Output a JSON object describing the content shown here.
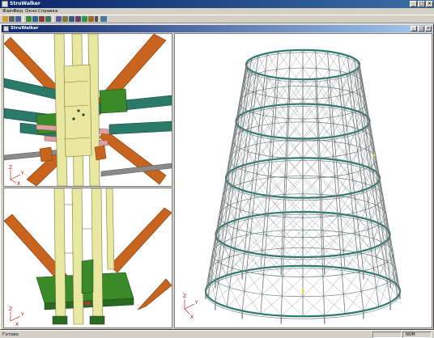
{
  "app": {
    "title": "StruWalker",
    "window_controls": {
      "minimize": "_",
      "maximize": "□",
      "close": "×"
    }
  },
  "menu": [
    "Файл",
    "Вид",
    "Окно",
    "Справка"
  ],
  "toolbar": {
    "icons": [
      "open-icon",
      "print-icon",
      "save-icon",
      "select-icon",
      "zoom-icon",
      "rotate-icon",
      "refresh-icon",
      "view-icon",
      "camera-icon",
      "pan-icon",
      "walk-icon",
      "light-icon",
      "settings-icon",
      "dropdown-icon",
      "measure-icon"
    ]
  },
  "child_window": {
    "title": "StruWalker",
    "controls": {
      "minimize": "_",
      "maximize": "□",
      "close": "×"
    }
  },
  "viewports": {
    "top_left": {
      "axis_labels": {
        "x": "X",
        "y": "Y",
        "z": "Z"
      }
    },
    "bottom_left": {
      "axis_labels": {
        "x": "X",
        "y": "Y",
        "z": "Z"
      }
    },
    "right": {
      "axis_labels": {
        "x": "X",
        "y": "Y",
        "z": "Z"
      }
    }
  },
  "status": {
    "text": "Готово",
    "indicator": "NUM"
  },
  "colors": {
    "steel_yellow": "#e8e8a0",
    "steel_orange": "#c8641e",
    "steel_teal": "#2a7a6a",
    "steel_green": "#3a8a2a",
    "steel_pink": "#e0a0a0",
    "mesh_grey": "#707878"
  }
}
